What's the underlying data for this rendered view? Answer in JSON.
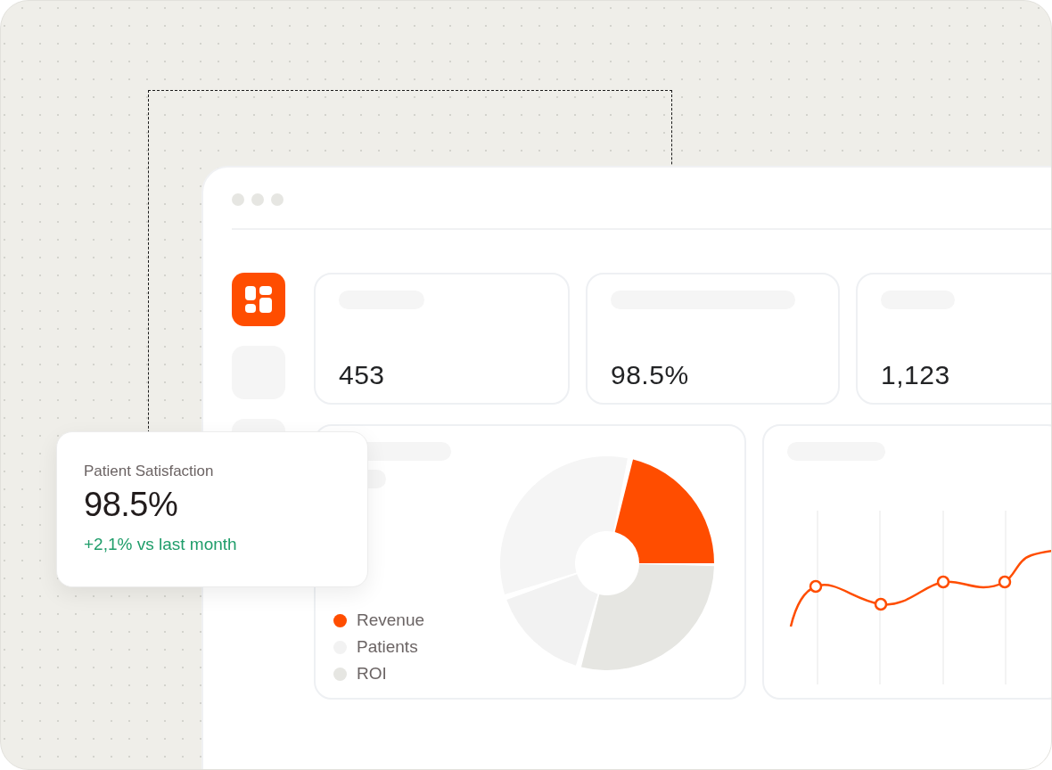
{
  "sidebar": {
    "items": [
      {
        "selected": true
      },
      {
        "selected": false
      },
      {
        "selected": false
      }
    ]
  },
  "stat_cards": [
    {
      "value": "453"
    },
    {
      "value": "98.5%"
    },
    {
      "value": "1,123"
    }
  ],
  "pie_card": {
    "legend": [
      {
        "label": "Revenue",
        "color": "#ff4d00"
      },
      {
        "label": "Patients",
        "color": "#f2f2f2"
      },
      {
        "label": "ROI",
        "color": "#e6e6e2"
      }
    ]
  },
  "floating_card": {
    "title": "Patient Satisfaction",
    "value": "98.5%",
    "change": "+2,1% vs last month"
  }
}
